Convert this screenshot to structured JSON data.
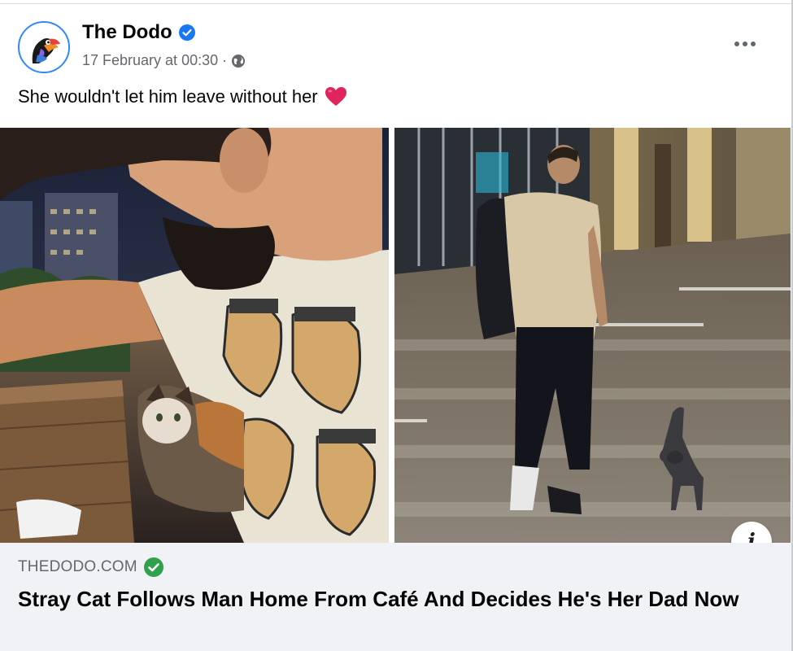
{
  "post": {
    "page_name": "The Dodo",
    "timestamp": "17 February at 00:30",
    "separator": "·",
    "caption": "She wouldn't let him leave without her"
  },
  "link": {
    "domain": "THEDODO.COM",
    "headline": "Stray Cat Follows Man Home From Café And Decides He's Her Dad Now"
  },
  "info_glyph": "i",
  "icons": {
    "verified": "verified-badge-icon",
    "audience": "globe-icon",
    "more": "more-options-icon",
    "reaction": "red-heart-emoji",
    "domain_check": "verified-check-icon",
    "info": "info-icon"
  },
  "colors": {
    "verified_blue": "#1877f2",
    "domain_check_green": "#31a24c",
    "heart_red": "#e0245e",
    "link_bg": "#f0f2f5"
  }
}
